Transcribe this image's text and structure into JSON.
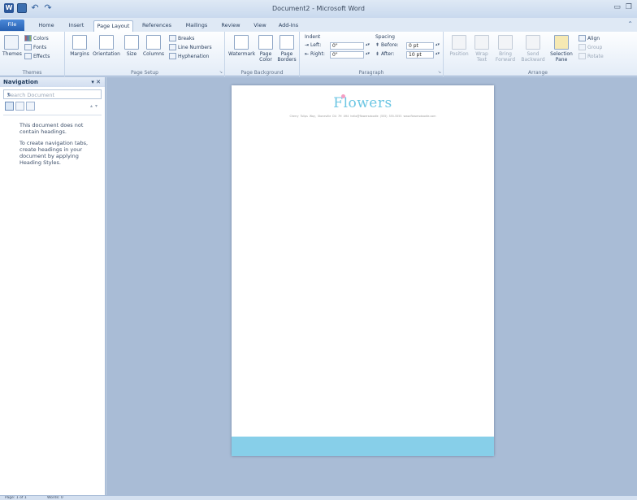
{
  "window": {
    "title": "Document2 - Microsoft Word",
    "qat_icons": [
      "word-icon",
      "save-icon",
      "undo-icon",
      "redo-icon"
    ]
  },
  "tabs": [
    {
      "label": "File",
      "key": "file"
    },
    {
      "label": "Home",
      "key": "home"
    },
    {
      "label": "Insert",
      "key": "insert"
    },
    {
      "label": "Page Layout",
      "key": "page-layout"
    },
    {
      "label": "References",
      "key": "references"
    },
    {
      "label": "Mailings",
      "key": "mailings"
    },
    {
      "label": "Review",
      "key": "review"
    },
    {
      "label": "View",
      "key": "view"
    },
    {
      "label": "Add-Ins",
      "key": "add-ins"
    }
  ],
  "active_tab": "Page Layout",
  "ribbon": {
    "themes": {
      "label": "Themes",
      "themes_btn": "Themes",
      "colors": "Colors",
      "fonts": "Fonts",
      "effects": "Effects"
    },
    "page_setup": {
      "label": "Page Setup",
      "margins": "Margins",
      "orientation": "Orientation",
      "size": "Size",
      "columns": "Columns",
      "breaks": "Breaks",
      "line_numbers": "Line Numbers",
      "hyphenation": "Hyphenation"
    },
    "page_background": {
      "label": "Page Background",
      "watermark": "Watermark",
      "page_color": "Page Color",
      "page_borders": "Page Borders"
    },
    "paragraph": {
      "label": "Paragraph",
      "indent": "Indent",
      "left_label": "Left:",
      "left_value": "0\"",
      "right_label": "Right:",
      "right_value": "0\"",
      "spacing": "Spacing",
      "before_label": "Before:",
      "before_value": "0 pt",
      "after_label": "After:",
      "after_value": "10 pt"
    },
    "arrange": {
      "label": "Arrange",
      "position": "Position",
      "wrap_text": "Wrap Text",
      "bring_forward": "Bring Forward",
      "send_backward": "Send Backward",
      "selection_pane": "Selection Pane",
      "align": "Align",
      "group": "Group",
      "rotate": "Rotate"
    }
  },
  "navigation": {
    "title": "Navigation",
    "search_placeholder": "Search Document",
    "message1": "This document does not contain headings.",
    "message2": "To create navigation tabs, create headings in your document by applying Heading Styles."
  },
  "document": {
    "logo_text": "Flowers",
    "contact_line": "Cherry Tulips Way, Stoneville D4 7H 4H4   hello@flowersdoodle   (555) 555-5555   www.flowersdoodle.com",
    "accent_color": "#6cc6e3",
    "footer_color": "#87cfe9"
  },
  "status": {
    "page": "Page: 1 of 1",
    "words": "Words: 0"
  }
}
